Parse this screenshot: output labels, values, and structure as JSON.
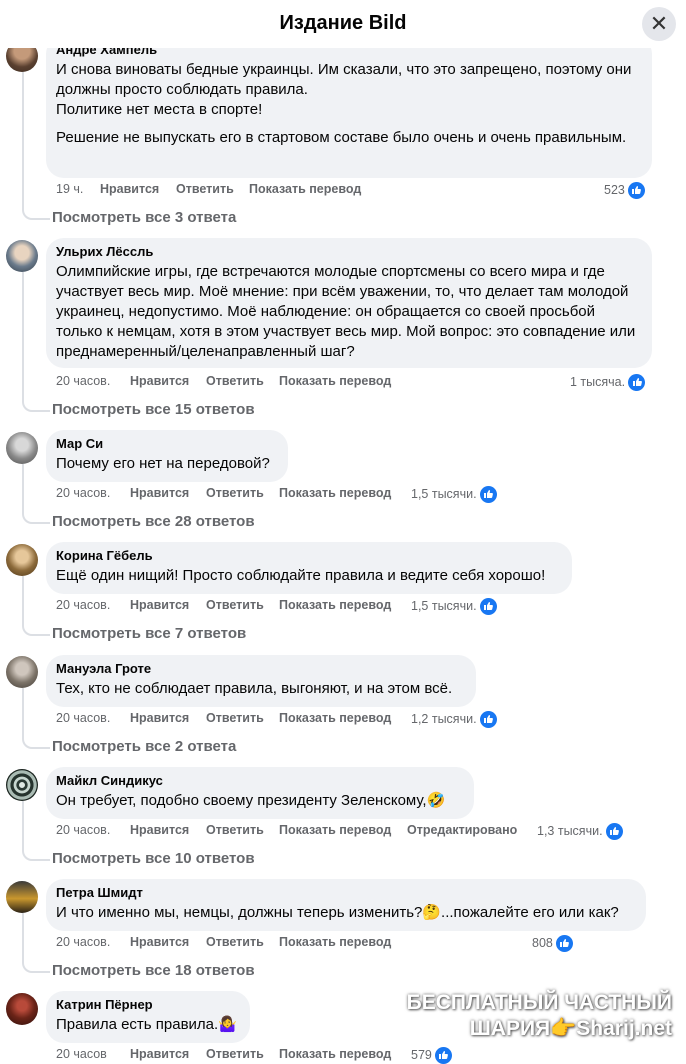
{
  "header": {
    "title": "Издание Bild",
    "close_icon": "close-icon"
  },
  "labels": {
    "like": "Нравится",
    "reply": "Ответить",
    "translate": "Показать перевод",
    "edited": "Отредактировано"
  },
  "comments": [
    {
      "author": "Андре Хампель",
      "paragraphs": [
        "И снова виноваты бедные украинцы. Им сказали, что это запрещено, поэтому они должны просто соблюдать правила.\nПолитике нет места в спорте!",
        "Решение не выпускать его в стартовом составе было очень и очень правильным."
      ],
      "time": "19 ч.",
      "reactions": "523",
      "replies": "Посмотреть все 3 ответа"
    },
    {
      "author": "Ульрих Лёссль",
      "paragraphs": [
        "Олимпийские игры, где встречаются молодые спортсмены со всего мира и где участвует весь мир. Моё мнение: при всём уважении, то, что делает там молодой украинец, недопустимо. Моё наблюдение: он обращается со своей просьбой только к немцам, хотя в этом участвует весь мир. Мой вопрос: это совпадение или преднамеренный/целенаправленный шаг?"
      ],
      "time": "20 часов.",
      "reactions": "1 тысяча.",
      "replies": "Посмотреть все 15 ответов"
    },
    {
      "author": "Мар Си",
      "paragraphs": [
        "Почему его нет на передовой?"
      ],
      "time": "20 часов.",
      "reactions": "1,5 тысячи.",
      "replies": "Посмотреть все 28 ответов"
    },
    {
      "author": "Корина Гёбель",
      "paragraphs": [
        "Ещё один нищий! Просто соблюдайте правила и ведите себя хорошо!"
      ],
      "time": "20 часов.",
      "reactions": "1,5 тысячи.",
      "replies": "Посмотреть все 7 ответов"
    },
    {
      "author": "Мануэла Гроте",
      "paragraphs": [
        "Тех, кто не соблюдает правила, выгоняют, и на этом всё."
      ],
      "time": "20 часов.",
      "reactions": "1,2 тысячи.",
      "replies": "Посмотреть все 2 ответа"
    },
    {
      "author": "Майкл Синдикус",
      "paragraphs": [
        "Он требует, подобно своему президенту Зеленскому,🤣"
      ],
      "time": "20 часов.",
      "reactions": "1,3 тысячи.",
      "replies": "Посмотреть все 10 ответов"
    },
    {
      "author": "Петра Шмидт",
      "paragraphs": [
        "И что именно мы, немцы, должны теперь изменить?🤔...пожалейте его или как?"
      ],
      "time": "20 часов.",
      "reactions": "808",
      "replies": "Посмотреть все 18 ответов"
    },
    {
      "author": "Катрин Пёрнер",
      "paragraphs": [
        "Правила есть правила.🤷‍♀️"
      ],
      "time": "20 часов",
      "reactions": "579"
    }
  ],
  "watermark": {
    "line1": "БЕСПЛАТНЫЙ ЧАСТНЫЙ",
    "line2": "ШАРИЯ👉Sharij.net"
  },
  "colors": {
    "like_blue": "#1877f2",
    "bubble": "#f0f2f5",
    "meta": "#65676b"
  }
}
